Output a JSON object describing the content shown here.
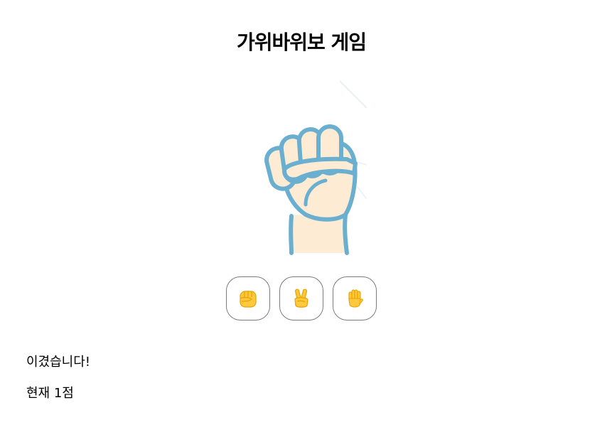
{
  "game": {
    "title": "가위바위보 게임",
    "current_hand": "rock",
    "current_hand_icon": "fist-hand-icon"
  },
  "choices": [
    {
      "value": "rock",
      "icon": "raised-fist-emoji-icon"
    },
    {
      "value": "scissors",
      "icon": "victory-hand-emoji-icon"
    },
    {
      "value": "paper",
      "icon": "raised-hand-emoji-icon"
    }
  ],
  "status": {
    "result_text": "이겼습니다!",
    "score_text": "현재 1점"
  },
  "colors": {
    "emoji_yellow": "#FFC83D",
    "emoji_outline": "#E8A100",
    "hand_fill": "#FDEBD3",
    "hand_stroke": "#6AAFD0",
    "button_border": "#7A7A7A"
  }
}
